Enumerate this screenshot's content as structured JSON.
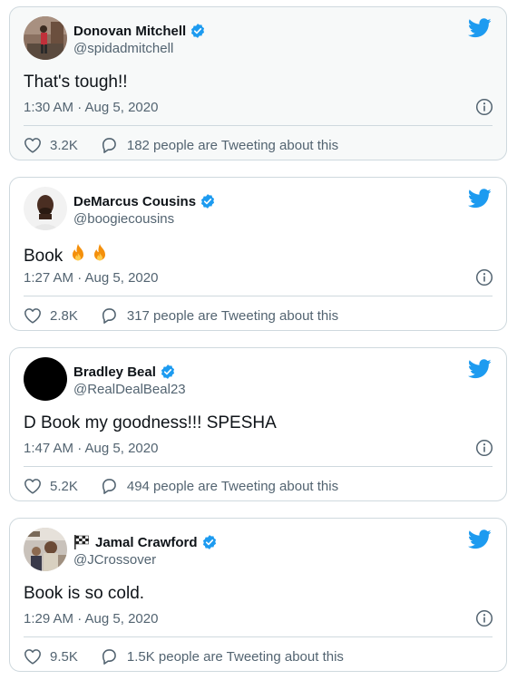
{
  "colors": {
    "verified": "#1d9bf0",
    "twitter_blue": "#1d9bf0",
    "secondary_text": "#536471",
    "border": "#cfd9de"
  },
  "tweets": [
    {
      "name": "Donovan Mitchell",
      "handle": "@spidadmitchell",
      "text": "That's tough!!",
      "time": "1:30 AM · Aug 5, 2020",
      "likes": "3.2K",
      "people": "182 people are Tweeting about this"
    },
    {
      "name": "DeMarcus Cousins",
      "handle": "@boogiecousins",
      "text": "Book",
      "emojis": "fire-icon fire-icon",
      "time": "1:27 AM · Aug 5, 2020",
      "likes": "2.8K",
      "people": "317 people are Tweeting about this"
    },
    {
      "name": "Bradley Beal",
      "handle": "@RealDealBeal23",
      "text": "D Book my goodness!!! SPESHA",
      "time": "1:47 AM · Aug 5, 2020",
      "likes": "5.2K",
      "people": "494 people are Tweeting about this"
    },
    {
      "name": "Jamal Crawford",
      "name_prefix_icon": "checkered-flag-icon",
      "handle": "@JCrossover",
      "text": "Book is so cold.",
      "time": "1:29 AM · Aug 5, 2020",
      "likes": "9.5K",
      "people": "1.5K people are Tweeting about this"
    }
  ]
}
